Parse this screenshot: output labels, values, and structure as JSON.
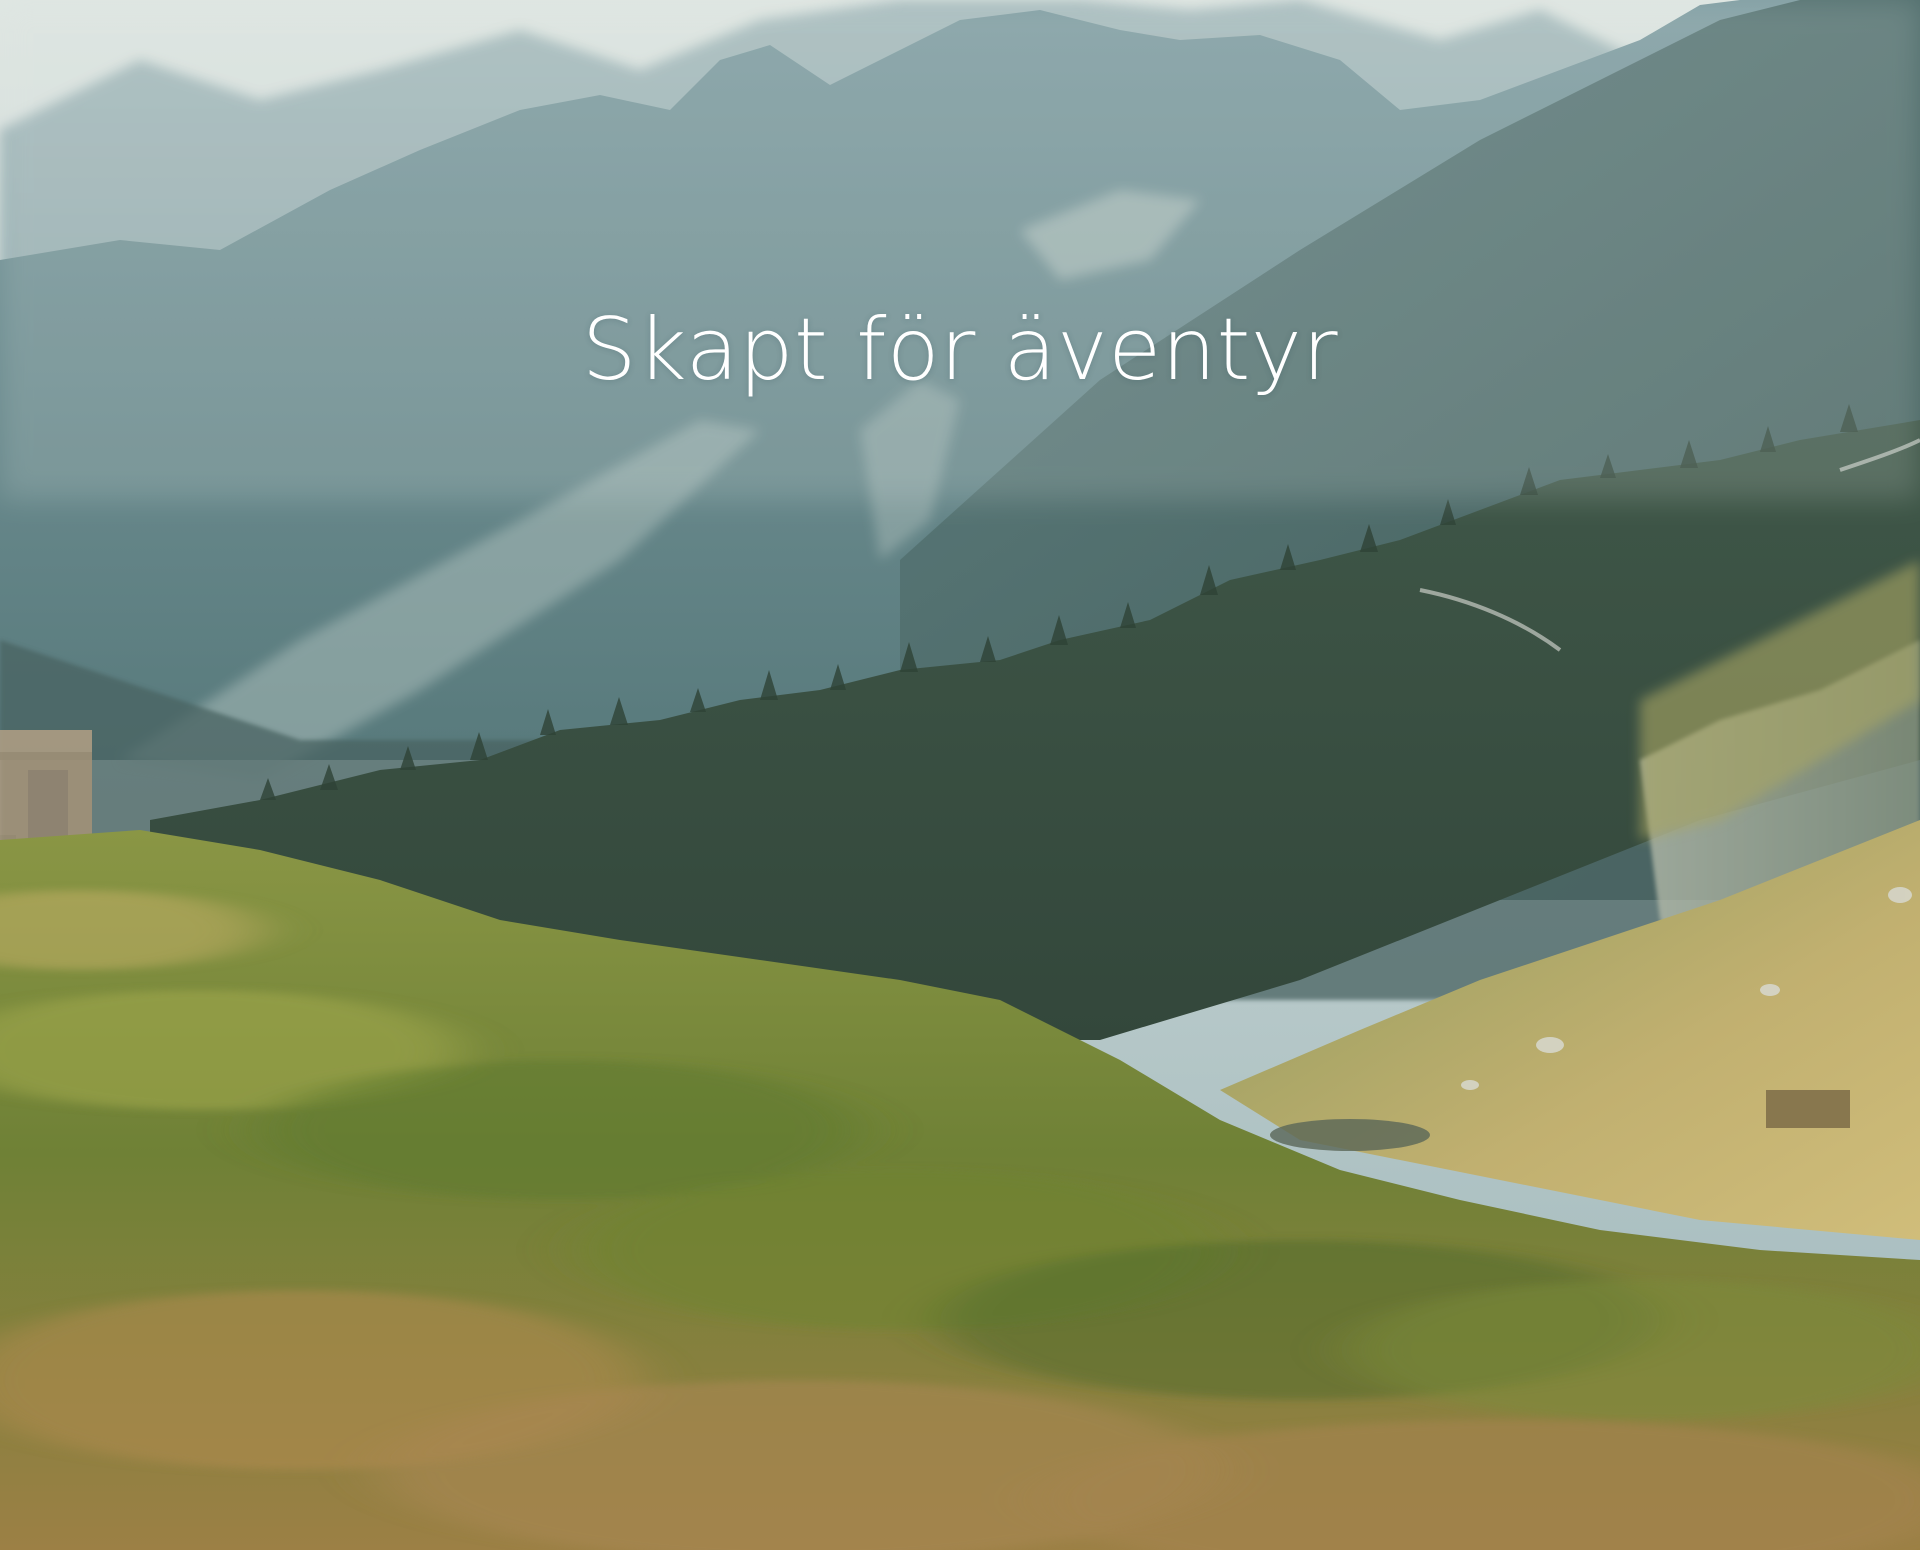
{
  "hero": {
    "headline": "Skapt för äventyr"
  },
  "colors": {
    "sky": "#c9d6d4",
    "far_mountains": "#9fb6b8",
    "mid_mountains": "#6f8f94",
    "near_mountains": "#4f6f70",
    "forest": "#3d5244",
    "right_slope": "#b8a866",
    "foreground_grass": "#7a8a3a",
    "foreground_dry": "#a98a4e",
    "headline_text": "#ffffff"
  }
}
